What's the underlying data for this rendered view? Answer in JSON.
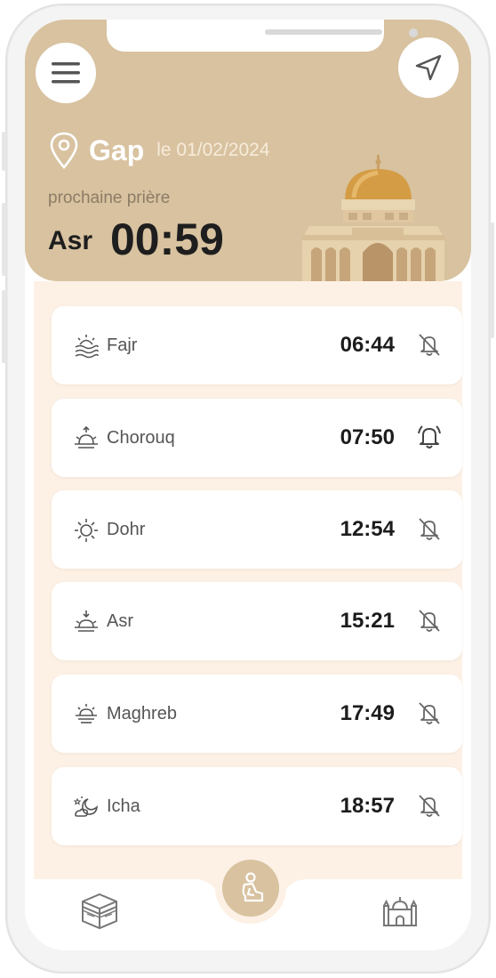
{
  "header": {
    "city": "Gap",
    "date": "le 01/02/2024",
    "next_label": "prochaine prière",
    "next_name": "Asr",
    "next_countdown": "00:59"
  },
  "icons": {
    "menu": "menu-icon",
    "location": "send-location-icon",
    "pin": "map-pin-icon"
  },
  "prayers": [
    {
      "name": "Fajr",
      "time": "06:44",
      "icon": "dawn-icon",
      "alarm": "off"
    },
    {
      "name": "Chorouq",
      "time": "07:50",
      "icon": "sunrise-icon",
      "alarm": "on"
    },
    {
      "name": "Dohr",
      "time": "12:54",
      "icon": "sun-icon",
      "alarm": "off"
    },
    {
      "name": "Asr",
      "time": "15:21",
      "icon": "afternoon-icon",
      "alarm": "off"
    },
    {
      "name": "Maghreb",
      "time": "17:49",
      "icon": "sunset-icon",
      "alarm": "off"
    },
    {
      "name": "Icha",
      "time": "18:57",
      "icon": "night-icon",
      "alarm": "off"
    }
  ],
  "bottom_nav": [
    "kaaba-icon",
    "prayer-icon",
    "mosque-icon"
  ],
  "colors": {
    "accent": "#d8c2a0",
    "background": "#fdf1e6",
    "text": "#1c1c1c"
  }
}
